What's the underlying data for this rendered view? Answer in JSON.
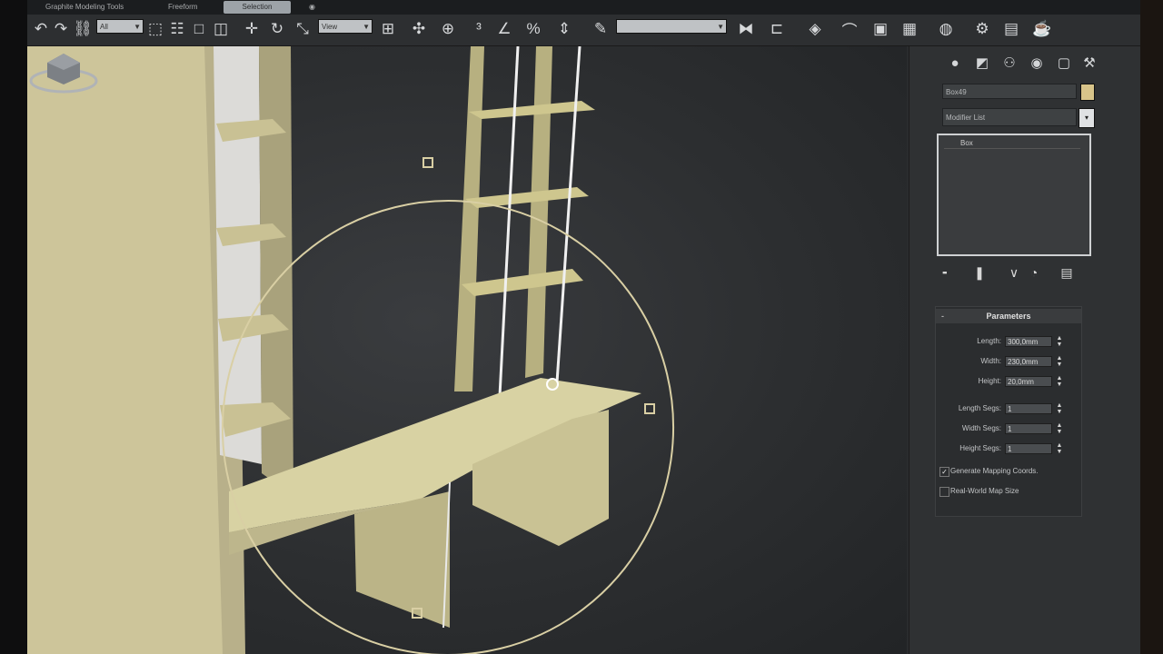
{
  "ribbon": {
    "tabs": [
      {
        "label": "Graphite Modeling Tools",
        "active": false
      },
      {
        "label": "Freeform",
        "active": false
      },
      {
        "label": "Selection",
        "active": true
      },
      {
        "label": "",
        "active": false
      }
    ]
  },
  "toolbar": {
    "selection_set": "All",
    "reference_coord": "View",
    "named_selection": "",
    "icons": [
      "undo-icon",
      "redo-icon",
      "link-icon",
      "select-filter-dropdown",
      "select-object-icon",
      "select-by-name-icon",
      "rect-region-icon",
      "window-crossing-icon",
      "move-icon",
      "rotate-icon",
      "scale-icon",
      "ref-coord-dropdown",
      "pivot-center-icon",
      "select-manipulate-icon",
      "keyboard-shortcut-icon",
      "snap-icon",
      "angle-snap-icon",
      "percent-snap-icon",
      "spinner-snap-icon",
      "edit-named-sets-icon",
      "named-selection-field",
      "mirror-icon",
      "align-icon",
      "layer-manager-icon",
      "curve-editor-icon",
      "schematic-view-icon",
      "material-editor-icon",
      "render-setup-icon",
      "rendered-frame-icon",
      "render-icon",
      "teapot-icon"
    ]
  },
  "command_panel": {
    "tabs": [
      "create-tab",
      "modify-tab",
      "hierarchy-tab",
      "motion-tab",
      "display-tab",
      "utilities-tab"
    ],
    "object_name": "Box49",
    "object_color": "#d8c48a",
    "modifier_list_label": "Modifier List",
    "stack_items": [
      "Box"
    ],
    "parameters": {
      "title": "Parameters",
      "length_label": "Length:",
      "length_value": "300,0mm",
      "width_label": "Width:",
      "width_value": "230,0mm",
      "height_label": "Height:",
      "height_value": "20,0mm",
      "length_segs_label": "Length Segs:",
      "length_segs_value": "1",
      "width_segs_label": "Width Segs:",
      "width_segs_value": "1",
      "height_segs_label": "Height Segs:",
      "height_segs_value": "1",
      "gen_mapping_label": "Generate Mapping Coords.",
      "gen_mapping_checked": true,
      "real_world_label": "Real-World Map Size",
      "real_world_checked": false
    }
  }
}
